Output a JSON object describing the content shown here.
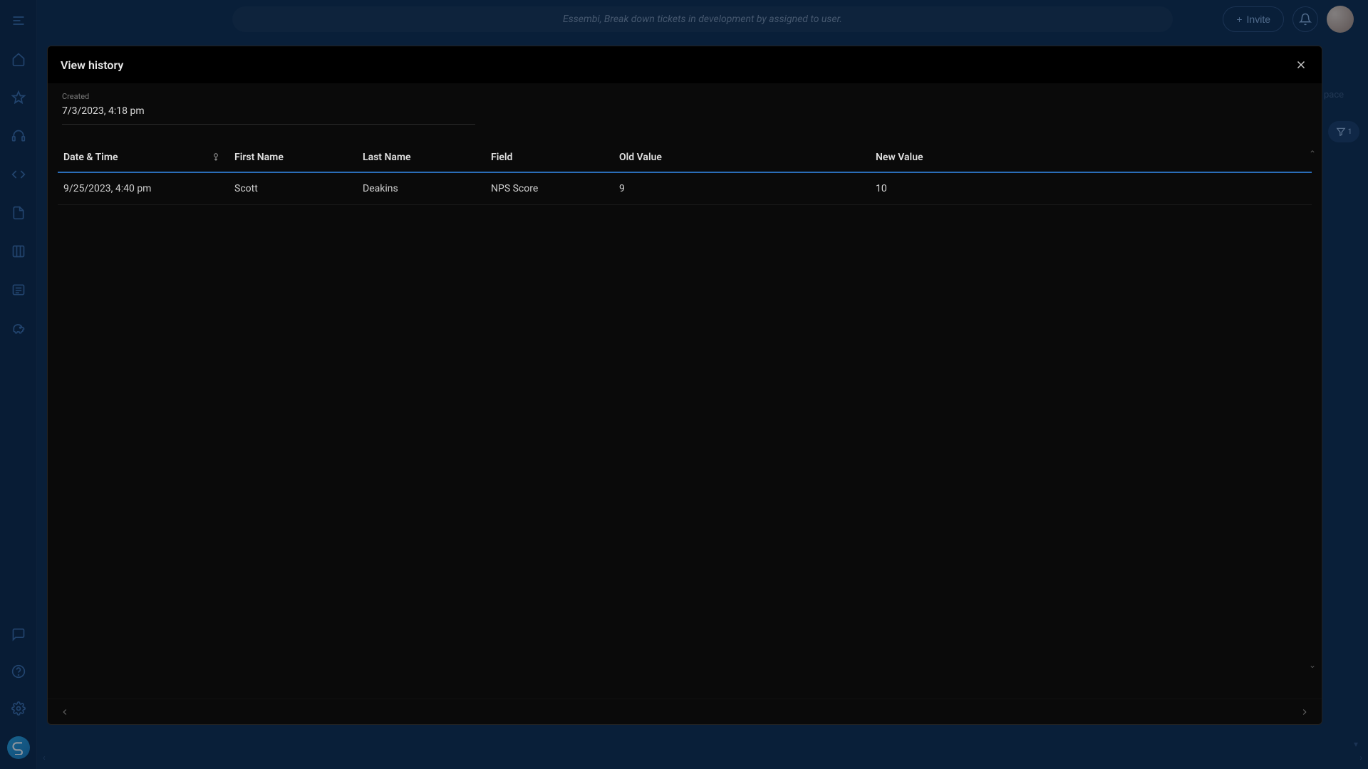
{
  "topbar": {
    "search_placeholder": "Essembi, Break down tickets in development by assigned to user.",
    "invite_label": "Invite"
  },
  "sidebar_obscured": {
    "label_fragment": "pace",
    "filter_badge": "1"
  },
  "modal": {
    "title": "View history",
    "created_label": "Created",
    "created_value": "7/3/2023, 4:18 pm",
    "columns": {
      "date_time": "Date & Time",
      "first_name": "First Name",
      "last_name": "Last Name",
      "field": "Field",
      "old_value": "Old Value",
      "new_value": "New Value"
    },
    "rows": [
      {
        "date_time": "9/25/2023, 4:40 pm",
        "first_name": "Scott",
        "last_name": "Deakins",
        "field": "NPS Score",
        "old_value": "9",
        "new_value": "10"
      }
    ]
  },
  "icons": {
    "rail": [
      "menu",
      "home",
      "star",
      "headset",
      "code",
      "document",
      "board",
      "form",
      "piggy-bank"
    ],
    "rail_bottom": [
      "chat",
      "help",
      "gear"
    ]
  }
}
